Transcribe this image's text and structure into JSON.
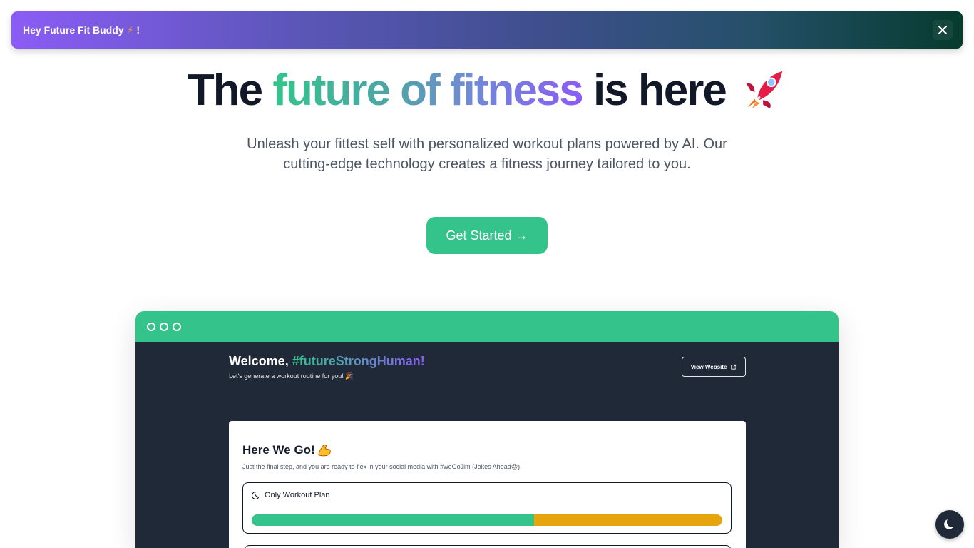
{
  "banner": {
    "greeting": "Hey Future Fit Buddy",
    "bolt": "⚡",
    "exclaim": "!"
  },
  "hero": {
    "title_pre": "The",
    "title_highlight": "future of fitness",
    "title_post": "is here",
    "subtitle": "Unleash your fittest self with personalized workout plans powered by AI. Our cutting-edge technology creates a fitness journey tailored to you.",
    "cta_label": "Get Started →"
  },
  "preview": {
    "welcome_prefix": "Welcome,",
    "welcome_name": "#futureStrongHuman!",
    "welcome_sub": "Let's generate a workout routine for you! 🎉",
    "view_website": "View Website",
    "card": {
      "title": "Here We Go!",
      "subtitle": "Just the final step, and you are ready to flex in your social media with #weGoJim (Jokes Ahead😜)",
      "plan_label": "Only Workout Plan",
      "progress": 0.6
    }
  },
  "colors": {
    "accent_green": "#34c48b",
    "accent_purple": "#8b5cf6",
    "progress_rest": "#e6a40d",
    "dark_bg": "#1f2937"
  },
  "icons": [
    "close-icon",
    "rocket-icon",
    "external-link-icon",
    "moon-icon",
    "flexed-biceps-icon"
  ]
}
